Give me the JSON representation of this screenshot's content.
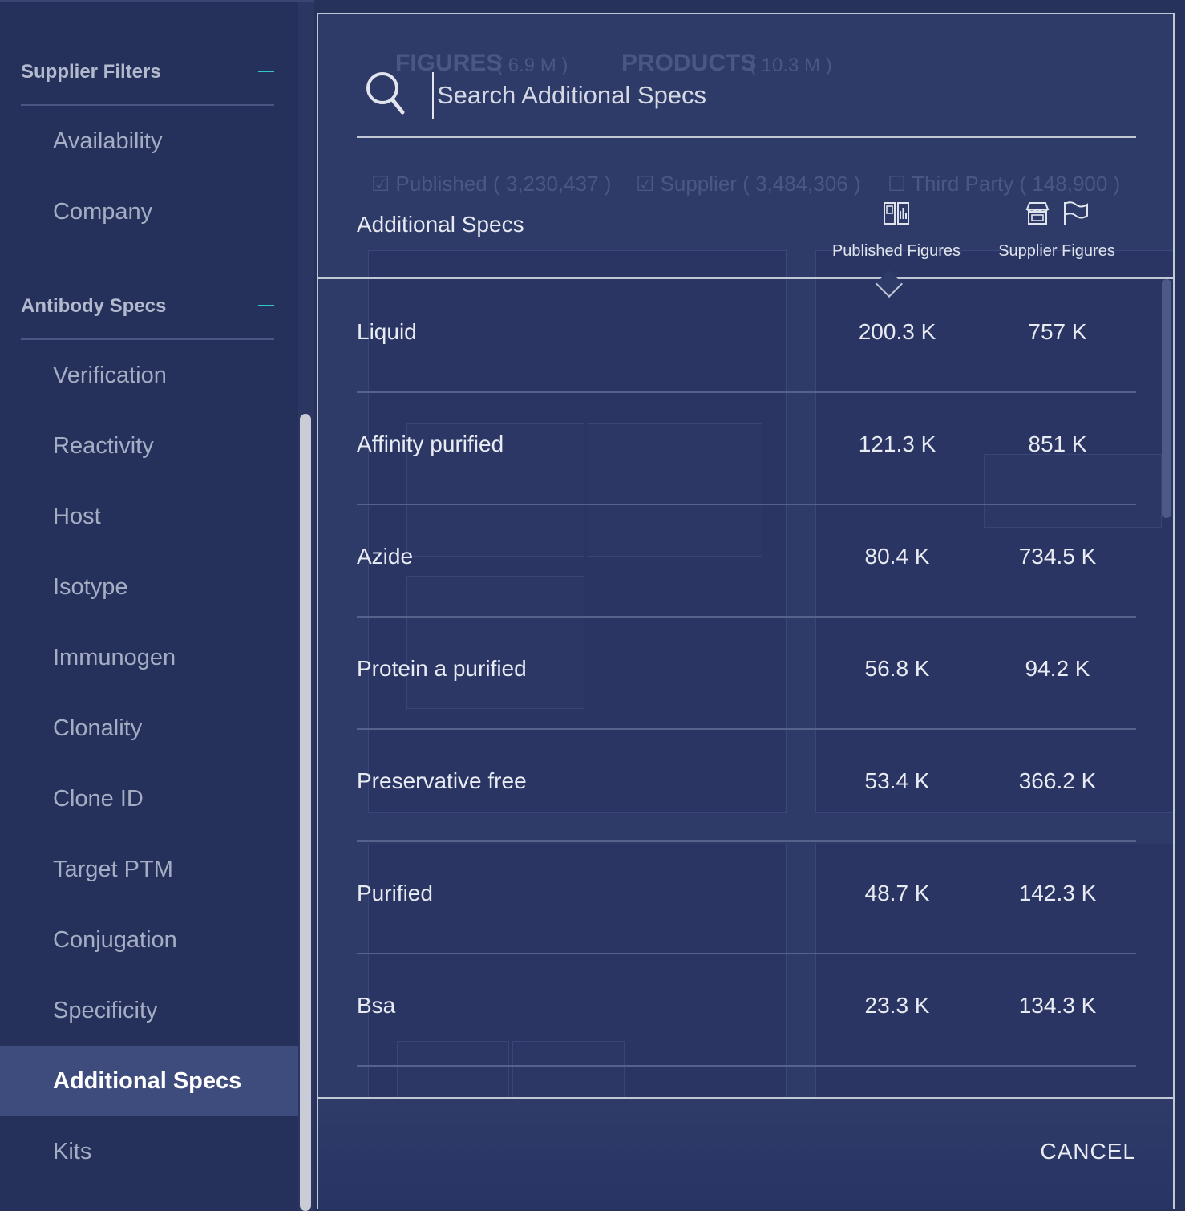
{
  "sidebar": {
    "sections": [
      {
        "title": "Supplier Filters",
        "items": [
          "Availability",
          "Company"
        ]
      },
      {
        "title": "Antibody Specs",
        "items": [
          "Verification",
          "Reactivity",
          "Host",
          "Isotype",
          "Immunogen",
          "Clonality",
          "Clone ID",
          "Target PTM",
          "Conjugation",
          "Specificity",
          "Additional Specs",
          "Kits"
        ]
      }
    ],
    "active_item": "Additional Specs"
  },
  "background": {
    "tabs": [
      {
        "label": "FIGURES",
        "count": "( 6.9 M )"
      },
      {
        "label": "PRODUCTS",
        "count": "( 10.3 M )"
      }
    ],
    "filters": [
      {
        "label": "Published",
        "count": "( 3,230,437 )"
      },
      {
        "label": "Supplier",
        "count": "( 3,484,306 )"
      },
      {
        "label": "Third Party",
        "count": "( 148,900 )"
      }
    ]
  },
  "dialog": {
    "search": {
      "placeholder": "Search Additional Specs",
      "value": ""
    },
    "header": {
      "label": "Additional Specs",
      "published_col": "Published Figures",
      "supplier_col": "Supplier Figures"
    },
    "rows": [
      {
        "name": "Liquid",
        "published": "200.3 K",
        "supplier": "757 K"
      },
      {
        "name": "Affinity purified",
        "published": "121.3 K",
        "supplier": "851 K"
      },
      {
        "name": "Azide",
        "published": "80.4 K",
        "supplier": "734.5 K"
      },
      {
        "name": "Protein a purified",
        "published": "56.8 K",
        "supplier": "94.2 K"
      },
      {
        "name": "Preservative free",
        "published": "53.4 K",
        "supplier": "366.2 K"
      },
      {
        "name": "Purified",
        "published": "48.7 K",
        "supplier": "142.3 K"
      },
      {
        "name": "Bsa",
        "published": "23.3 K",
        "supplier": "134.3 K"
      }
    ],
    "cancel_label": "CANCEL"
  },
  "colors": {
    "accent": "#2fc8c4",
    "sidebar_bg": "#25305b",
    "dialog_bg": "#2e3a67"
  }
}
